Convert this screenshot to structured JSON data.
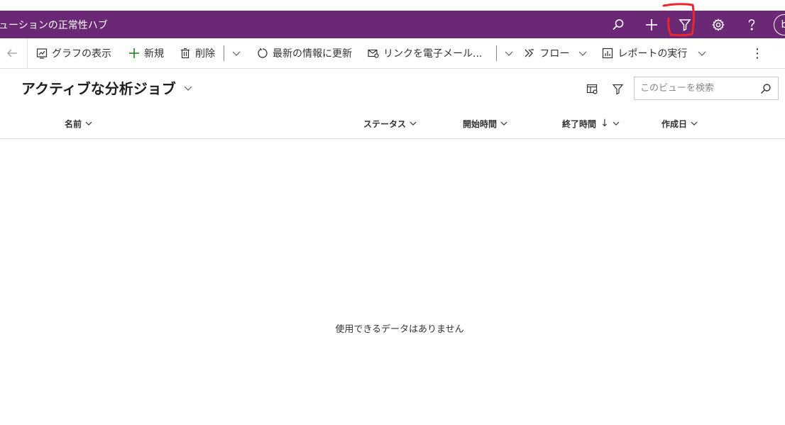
{
  "header": {
    "app_title": "ューションの正常性ハブ",
    "avatar_initial": "b"
  },
  "commands": {
    "show_chart": "グラフの表示",
    "new": "新規",
    "delete": "削除",
    "refresh": "最新の情報に更新",
    "email_link": "リンクを電子メール...",
    "flow": "フロー",
    "run_report": "レポートの実行"
  },
  "view": {
    "title": "アクティブな分析ジョブ"
  },
  "search": {
    "placeholder": "このビューを検索"
  },
  "columns": {
    "name": "名前",
    "status": "ステータス",
    "start_time": "開始時間",
    "end_time": "終了時間",
    "created": "作成日",
    "sort_indicator": "↓"
  },
  "empty_message": "使用できるデータはありません",
  "colors": {
    "header_bg": "#6b2874",
    "annotation": "#e8262b",
    "new_icon": "#107c10"
  }
}
